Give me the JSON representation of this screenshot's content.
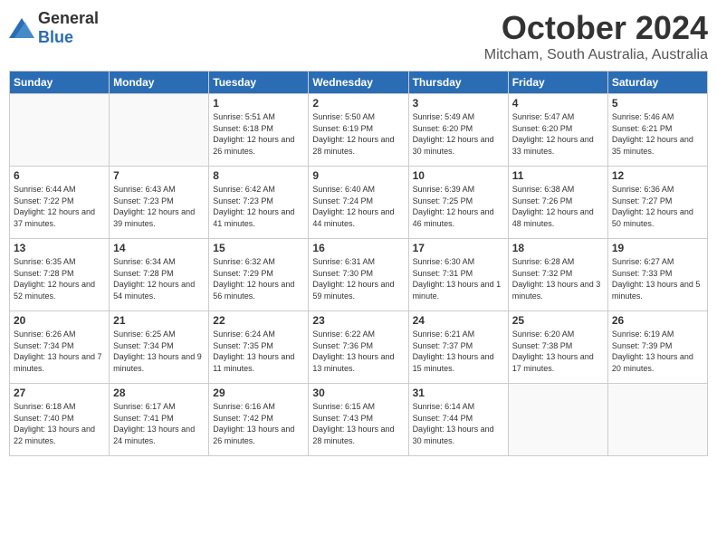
{
  "logo": {
    "general": "General",
    "blue": "Blue"
  },
  "header": {
    "month": "October 2024",
    "location": "Mitcham, South Australia, Australia"
  },
  "weekdays": [
    "Sunday",
    "Monday",
    "Tuesday",
    "Wednesday",
    "Thursday",
    "Friday",
    "Saturday"
  ],
  "weeks": [
    [
      {
        "day": "",
        "detail": ""
      },
      {
        "day": "",
        "detail": ""
      },
      {
        "day": "1",
        "detail": "Sunrise: 5:51 AM\nSunset: 6:18 PM\nDaylight: 12 hours\nand 26 minutes."
      },
      {
        "day": "2",
        "detail": "Sunrise: 5:50 AM\nSunset: 6:19 PM\nDaylight: 12 hours\nand 28 minutes."
      },
      {
        "day": "3",
        "detail": "Sunrise: 5:49 AM\nSunset: 6:20 PM\nDaylight: 12 hours\nand 30 minutes."
      },
      {
        "day": "4",
        "detail": "Sunrise: 5:47 AM\nSunset: 6:20 PM\nDaylight: 12 hours\nand 33 minutes."
      },
      {
        "day": "5",
        "detail": "Sunrise: 5:46 AM\nSunset: 6:21 PM\nDaylight: 12 hours\nand 35 minutes."
      }
    ],
    [
      {
        "day": "6",
        "detail": "Sunrise: 6:44 AM\nSunset: 7:22 PM\nDaylight: 12 hours\nand 37 minutes."
      },
      {
        "day": "7",
        "detail": "Sunrise: 6:43 AM\nSunset: 7:23 PM\nDaylight: 12 hours\nand 39 minutes."
      },
      {
        "day": "8",
        "detail": "Sunrise: 6:42 AM\nSunset: 7:23 PM\nDaylight: 12 hours\nand 41 minutes."
      },
      {
        "day": "9",
        "detail": "Sunrise: 6:40 AM\nSunset: 7:24 PM\nDaylight: 12 hours\nand 44 minutes."
      },
      {
        "day": "10",
        "detail": "Sunrise: 6:39 AM\nSunset: 7:25 PM\nDaylight: 12 hours\nand 46 minutes."
      },
      {
        "day": "11",
        "detail": "Sunrise: 6:38 AM\nSunset: 7:26 PM\nDaylight: 12 hours\nand 48 minutes."
      },
      {
        "day": "12",
        "detail": "Sunrise: 6:36 AM\nSunset: 7:27 PM\nDaylight: 12 hours\nand 50 minutes."
      }
    ],
    [
      {
        "day": "13",
        "detail": "Sunrise: 6:35 AM\nSunset: 7:28 PM\nDaylight: 12 hours\nand 52 minutes."
      },
      {
        "day": "14",
        "detail": "Sunrise: 6:34 AM\nSunset: 7:28 PM\nDaylight: 12 hours\nand 54 minutes."
      },
      {
        "day": "15",
        "detail": "Sunrise: 6:32 AM\nSunset: 7:29 PM\nDaylight: 12 hours\nand 56 minutes."
      },
      {
        "day": "16",
        "detail": "Sunrise: 6:31 AM\nSunset: 7:30 PM\nDaylight: 12 hours\nand 59 minutes."
      },
      {
        "day": "17",
        "detail": "Sunrise: 6:30 AM\nSunset: 7:31 PM\nDaylight: 13 hours\nand 1 minute."
      },
      {
        "day": "18",
        "detail": "Sunrise: 6:28 AM\nSunset: 7:32 PM\nDaylight: 13 hours\nand 3 minutes."
      },
      {
        "day": "19",
        "detail": "Sunrise: 6:27 AM\nSunset: 7:33 PM\nDaylight: 13 hours\nand 5 minutes."
      }
    ],
    [
      {
        "day": "20",
        "detail": "Sunrise: 6:26 AM\nSunset: 7:34 PM\nDaylight: 13 hours\nand 7 minutes."
      },
      {
        "day": "21",
        "detail": "Sunrise: 6:25 AM\nSunset: 7:34 PM\nDaylight: 13 hours\nand 9 minutes."
      },
      {
        "day": "22",
        "detail": "Sunrise: 6:24 AM\nSunset: 7:35 PM\nDaylight: 13 hours\nand 11 minutes."
      },
      {
        "day": "23",
        "detail": "Sunrise: 6:22 AM\nSunset: 7:36 PM\nDaylight: 13 hours\nand 13 minutes."
      },
      {
        "day": "24",
        "detail": "Sunrise: 6:21 AM\nSunset: 7:37 PM\nDaylight: 13 hours\nand 15 minutes."
      },
      {
        "day": "25",
        "detail": "Sunrise: 6:20 AM\nSunset: 7:38 PM\nDaylight: 13 hours\nand 17 minutes."
      },
      {
        "day": "26",
        "detail": "Sunrise: 6:19 AM\nSunset: 7:39 PM\nDaylight: 13 hours\nand 20 minutes."
      }
    ],
    [
      {
        "day": "27",
        "detail": "Sunrise: 6:18 AM\nSunset: 7:40 PM\nDaylight: 13 hours\nand 22 minutes."
      },
      {
        "day": "28",
        "detail": "Sunrise: 6:17 AM\nSunset: 7:41 PM\nDaylight: 13 hours\nand 24 minutes."
      },
      {
        "day": "29",
        "detail": "Sunrise: 6:16 AM\nSunset: 7:42 PM\nDaylight: 13 hours\nand 26 minutes."
      },
      {
        "day": "30",
        "detail": "Sunrise: 6:15 AM\nSunset: 7:43 PM\nDaylight: 13 hours\nand 28 minutes."
      },
      {
        "day": "31",
        "detail": "Sunrise: 6:14 AM\nSunset: 7:44 PM\nDaylight: 13 hours\nand 30 minutes."
      },
      {
        "day": "",
        "detail": ""
      },
      {
        "day": "",
        "detail": ""
      }
    ]
  ]
}
